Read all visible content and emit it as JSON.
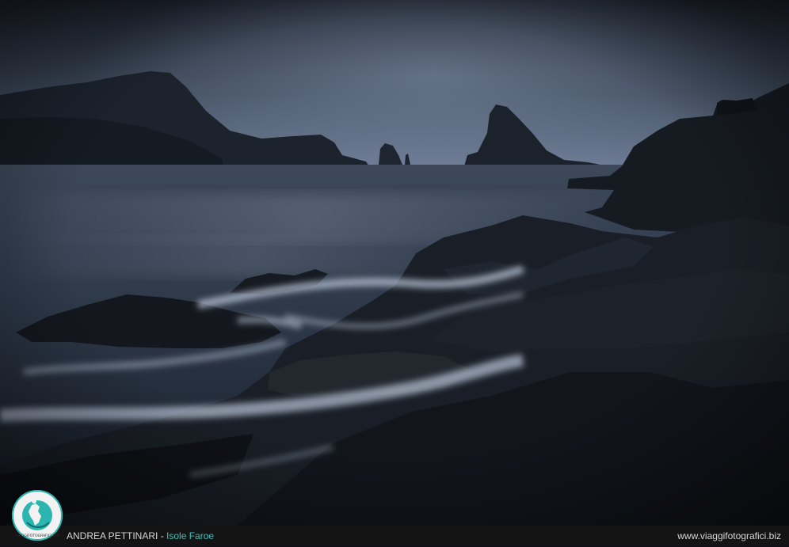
{
  "footer": {
    "photographer": "ANDREA PETTINARI",
    "separator": " - ",
    "location": "Isole Faroe",
    "website": "www.viaggifotografici.biz"
  },
  "logo": {
    "text": "VIAGGIFOTOGRAFICI.BIZ",
    "accent_color": "#2ab5b0"
  },
  "colors": {
    "sky_top": "#1b212c",
    "sky_horizon": "#6c7c95",
    "sea": "#2f3a4a",
    "rock": "#15191f",
    "footer_bg": "#141414",
    "location_accent": "#39c3bd"
  }
}
